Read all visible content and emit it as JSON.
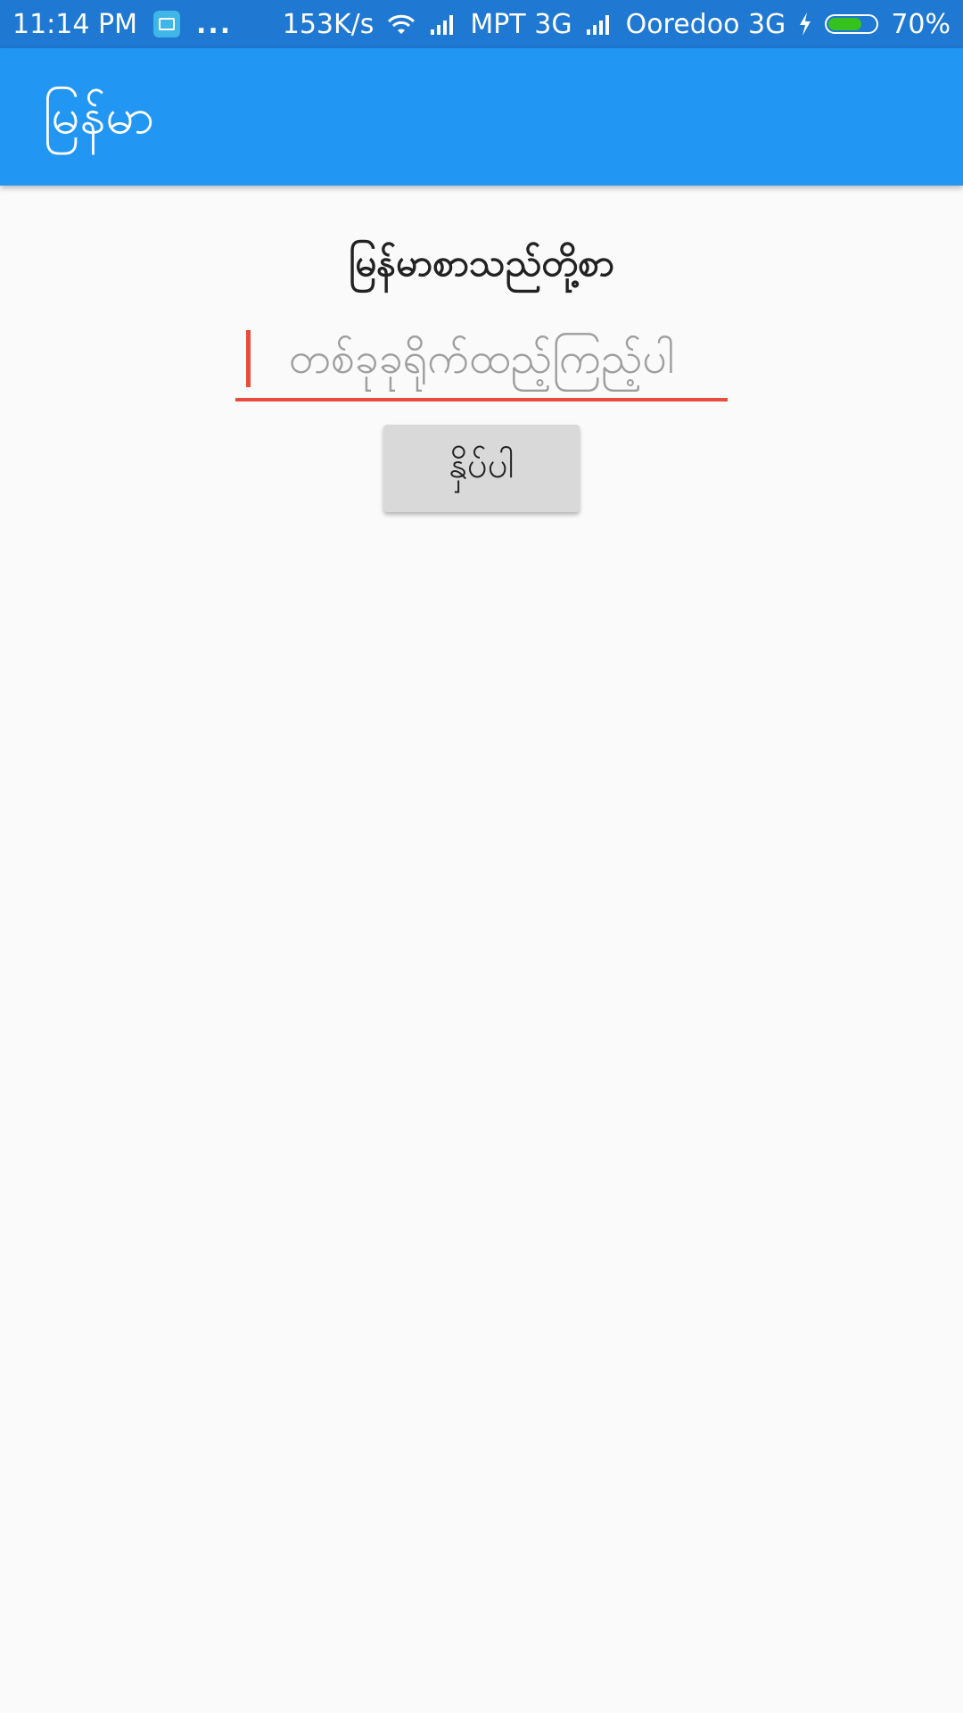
{
  "status_bar": {
    "time": "11:14 PM",
    "more_dots": "...",
    "net_speed": "153K/s",
    "carrier1": "MPT 3G",
    "carrier2": "Ooredoo 3G",
    "battery_text": "70%",
    "battery_level": 0.7
  },
  "app_bar": {
    "title": "မြန်မာ"
  },
  "main": {
    "label": "မြန်မာစာသည်တို့စာ",
    "input": {
      "value": "",
      "placeholder": "တစ်ခုခုရိုက်ထည့်ကြည့်ပါ"
    },
    "button_label": "နှိပ်ပါ"
  },
  "colors": {
    "status_bar": "#1f78d1",
    "app_bar": "#2196f3",
    "accent_underline": "#e74c3c",
    "button_bg": "#d9d9d9",
    "background": "#fafafa"
  }
}
